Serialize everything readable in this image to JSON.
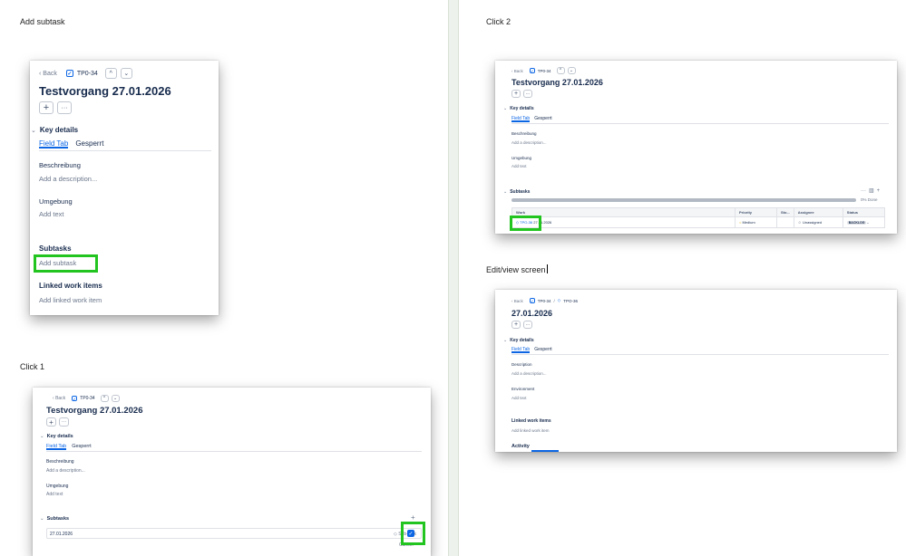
{
  "annotations": {
    "add_subtask": "Add subtask",
    "click_1": "Click 1",
    "click_2": "Click 2",
    "edit_view": "Edit/view screen"
  },
  "issue": {
    "back": "Back",
    "key": "TP0-34",
    "title": "Testvorgang 27.01.2026",
    "plus": "+",
    "more": "···",
    "key_details": "Key details",
    "tab_field": "Field Tab",
    "tab_locked": "Gesperrt",
    "beschreibung": "Beschreibung",
    "add_description": "Add a description...",
    "umgebung": "Umgebung",
    "add_text": "Add text",
    "subtasks": "Subtasks",
    "add_subtask": "Add subtask",
    "linked": "Linked work items",
    "add_linked": "Add linked work item"
  },
  "click1": {
    "subtask_input_value": "27.01.2026",
    "subtask_type": "Sub-task",
    "cancel": "Cancel",
    "confirm": "✓"
  },
  "click2": {
    "progress_text": "0% Done",
    "columns": [
      "Work",
      "Priority",
      "Sto...",
      "Assignee",
      "Status"
    ],
    "row": {
      "key": "TPO-36",
      "summary": "27.01.2026",
      "priority": "Medium",
      "assignee": "Unassigned",
      "status": "BACKLOG"
    }
  },
  "editview": {
    "breadcrumb_parent": "TP0-34",
    "breadcrumb_sep": "/",
    "breadcrumb_child": "TPO-36",
    "title": "27.01.2026",
    "description": "Description",
    "environment": "Environment",
    "activity": "Activity"
  },
  "colors": {
    "highlight": "#22c41f",
    "accent": "#0c66e4"
  }
}
